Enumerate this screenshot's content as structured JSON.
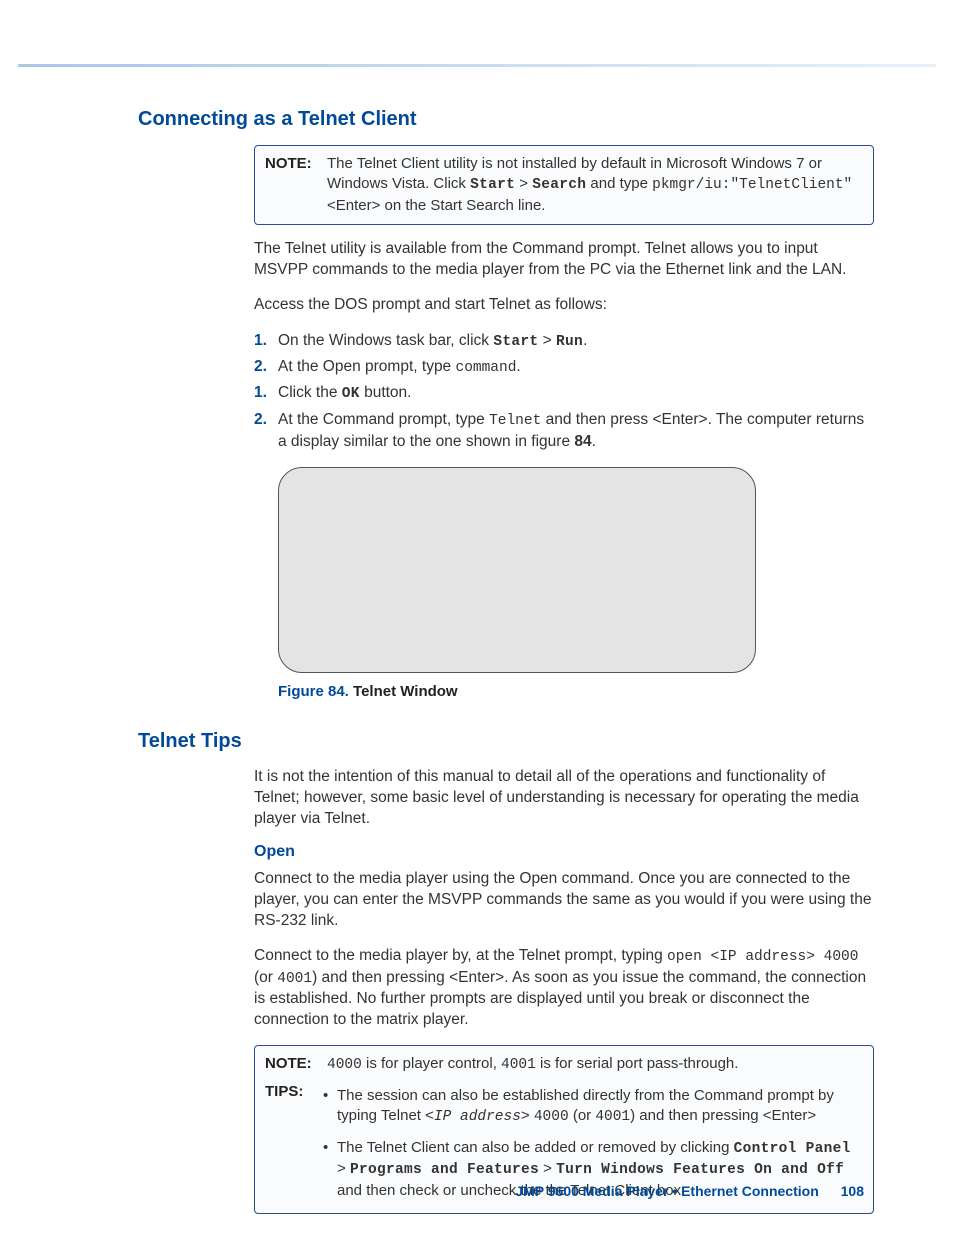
{
  "section1": {
    "title": "Connecting as a Telnet Client",
    "note": {
      "label": "NOTE:",
      "text_a": "The Telnet Client utility is not installed by default in Microsoft Windows 7 or Windows Vista. Click ",
      "start": "Start",
      "gt1": " > ",
      "search": "Search",
      "text_b": " and type ",
      "cmd": "pkmgr/iu:\"TelnetClient\"",
      "text_c": " <Enter> on the Start Search line."
    },
    "p1": "The Telnet utility is available from the Command prompt. Telnet allows you to input MSVPP commands to the media player from the PC via the Ethernet link and the LAN.",
    "p2": "Access the DOS prompt and start Telnet as follows:",
    "steps": [
      {
        "n": "1.",
        "pre": "On the Windows task bar, click ",
        "b1": "Start",
        "mid": " > ",
        "b2": "Run",
        "post": "."
      },
      {
        "n": "2.",
        "pre": "At the Open prompt, type ",
        "mono": "command",
        "post": "."
      },
      {
        "n": "1.",
        "pre": "Click the ",
        "b1": "OK",
        "post": " button."
      },
      {
        "n": "2.",
        "pre": "At the Command prompt, type ",
        "mono": "Telnet",
        "mid": " and then press <Enter>. The computer returns a display similar to the one shown in figure ",
        "b1": "84",
        "post": "."
      }
    ],
    "figure": {
      "num": "Figure 84.",
      "title": " Telnet Window"
    }
  },
  "section2": {
    "title": "Telnet Tips",
    "p1": "It is not the intention of this manual to detail all of the operations and functionality of Telnet; however, some basic level of understanding is necessary for operating the media player via Telnet.",
    "open": {
      "heading": "Open",
      "p1": "Connect to the media player using the Open command. Once you are connected to the player, you can enter the MSVPP commands the same as you would if you were using the RS-232 link.",
      "p2a": "Connect to the media player by, at the Telnet prompt, typing ",
      "p2_cmd": "open <IP address> 4000",
      "p2b": " (or ",
      "p2_alt": "4001",
      "p2c": ") and then pressing <Enter>. As soon as you issue the command, the connection is established. No further prompts are displayed until you break or disconnect the connection to the matrix player."
    },
    "note2": {
      "label": "NOTE:",
      "a": "4000",
      "b": " is for player control, ",
      "c": "4001",
      "d": " is for serial port pass-through."
    },
    "tips": {
      "label": "TIPS:",
      "b1a": "The session can also be established directly from the Command prompt by typing Telnet <",
      "b1_ip": "IP address",
      "b1b": "> ",
      "b1_p1": "4000",
      "b1c": " (or ",
      "b1_p2": "4001",
      "b1d": ") and then pressing <Enter>",
      "b2a": "The Telnet Client can also be added or removed by clicking ",
      "b2_cp": "Control Panel",
      "b2_gt1": " > ",
      "b2_pf": "Programs and Features",
      "b2_gt2": " > ",
      "b2_tw": "Turn Windows Features On and Off",
      "b2b": " and then check or uncheck the the Telnet Client box."
    }
  },
  "footer": {
    "text": "JMP 9600 Media Player • Ethernet Connection",
    "page": "108"
  }
}
